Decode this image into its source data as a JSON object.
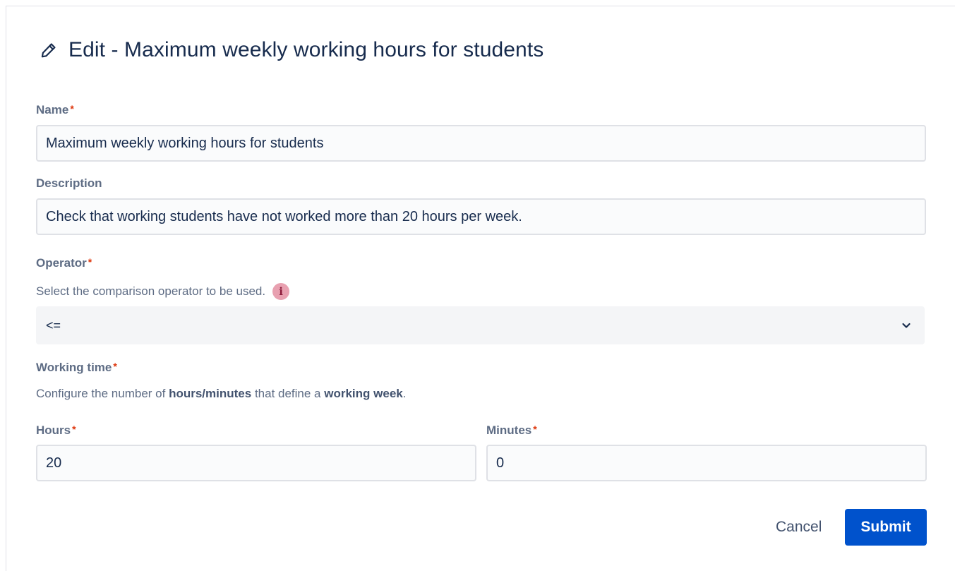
{
  "dialog": {
    "title": "Edit - Maximum weekly working hours for students",
    "title_icon": "pencil-icon"
  },
  "form": {
    "name": {
      "label": "Name",
      "required_mark": "*",
      "value": "Maximum weekly working hours for students"
    },
    "description": {
      "label": "Description",
      "value": "Check that working students have not worked more than 20 hours per week."
    },
    "operator": {
      "label": "Operator",
      "required_mark": "*",
      "helper": "Select the comparison operator to be used.",
      "info_icon": "info-icon",
      "info_glyph": "i",
      "selected": "<=",
      "dropdown_icon": "chevron-down-icon"
    },
    "working_time": {
      "label": "Working time",
      "required_mark": "*",
      "helper_prefix": "Configure the number of",
      "helper_bold1": "hours/minutes",
      "helper_middle": "that define a",
      "helper_bold2": "working week",
      "helper_suffix": ".",
      "hours": {
        "label": "Hours",
        "required_mark": "*",
        "value": "20"
      },
      "minutes": {
        "label": "Minutes",
        "required_mark": "*",
        "value": "0"
      }
    }
  },
  "actions": {
    "cancel_label": "Cancel",
    "submit_label": "Submit"
  },
  "colors": {
    "primary": "#0052cc",
    "required": "#de350b",
    "info_bg": "#e8a0b0",
    "text": "#172b4d",
    "label": "#5e6c84"
  }
}
